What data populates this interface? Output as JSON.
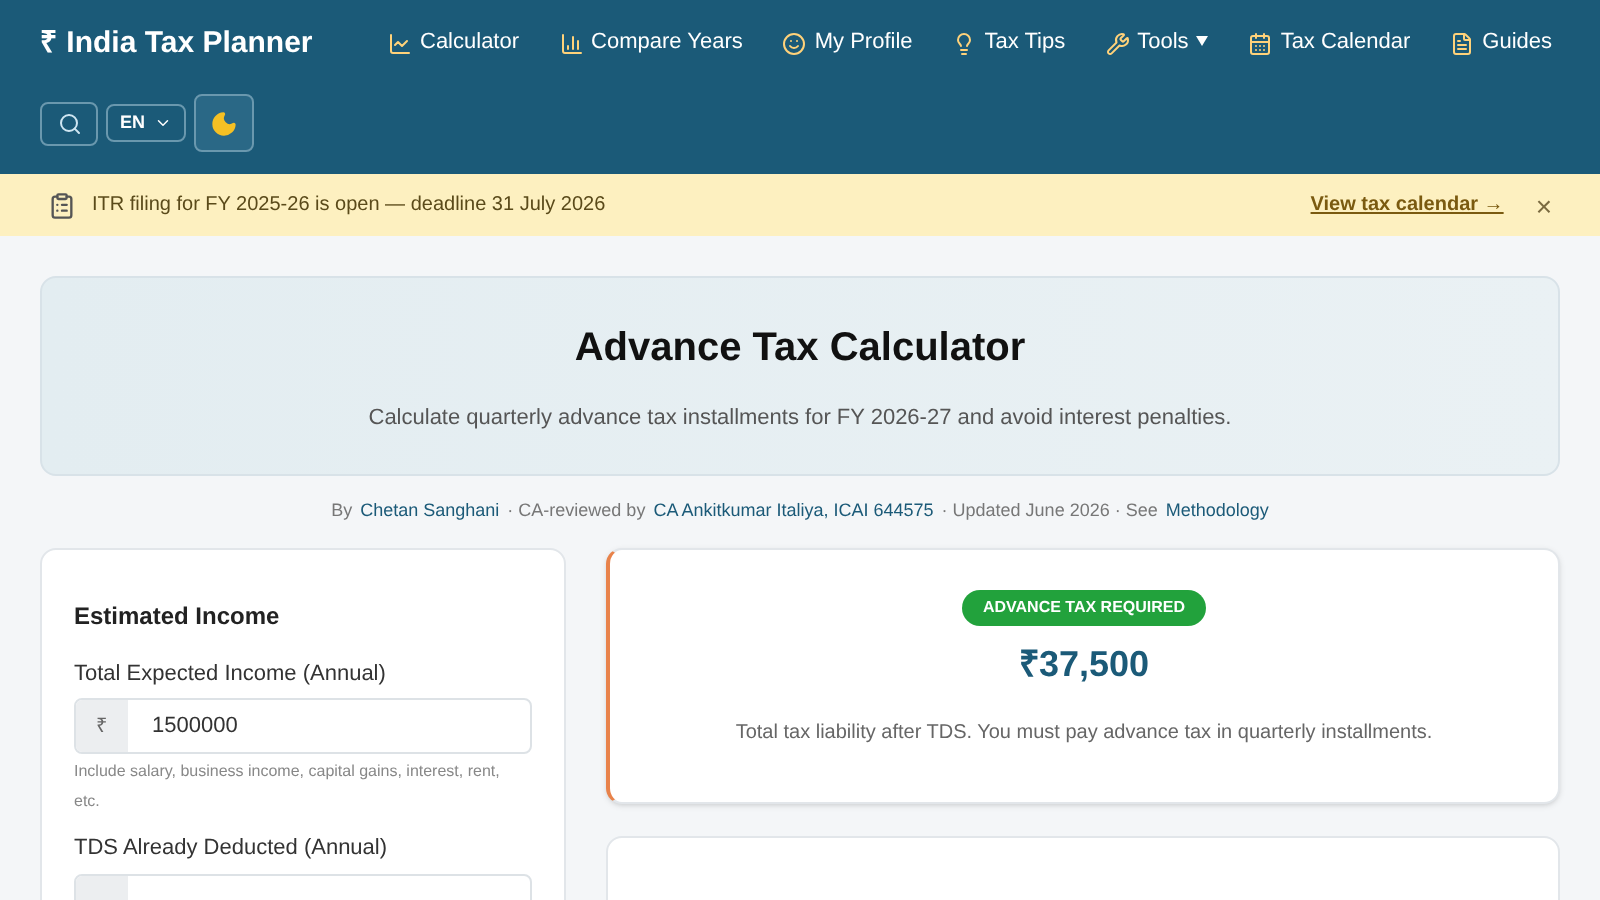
{
  "header": {
    "logo": "₹ India Tax Planner",
    "nav": [
      {
        "label": "Calculator",
        "has_menu": false
      },
      {
        "label": "Compare Years",
        "has_menu": false
      },
      {
        "label": "My Profile",
        "has_menu": false
      },
      {
        "label": "Tax Tips",
        "has_menu": false
      },
      {
        "label": "Tools",
        "has_menu": true
      },
      {
        "label": "Tax Calendar",
        "has_menu": false
      },
      {
        "label": "Guides",
        "has_menu": false
      }
    ],
    "language": "EN"
  },
  "banner": {
    "text": "ITR filing for FY 2025-26 is open — deadline 31 July 2026",
    "link": "View tax calendar →",
    "close": "×"
  },
  "hero": {
    "title": "Advance Tax Calculator",
    "subtitle": "Calculate quarterly advance tax installments for FY 2026-27 and avoid interest penalties."
  },
  "byline": [
    {
      "text": "By",
      "link": false
    },
    {
      "text": "Chetan Sanghani",
      "link": true
    },
    {
      "text": "· CA-reviewed by",
      "link": false
    },
    {
      "text": "CA Ankitkumar Italiya, ICAI 644575",
      "link": true
    },
    {
      "text": "· Updated June 2026 · See",
      "link": false
    },
    {
      "text": "Methodology",
      "link": true
    }
  ],
  "form": {
    "title": "Estimated Income",
    "fields": [
      {
        "label": "Total Expected Income (Annual)",
        "prefix": "₹",
        "value": "1500000",
        "help": "Include salary, business income, capital gains, interest, rent, etc."
      },
      {
        "label": "TDS Already Deducted (Annual)"
      }
    ]
  },
  "result": {
    "badge": "ADVANCE TAX REQUIRED",
    "amount": "₹37,500",
    "note": "Total tax liability after TDS. You must pay advance tax in quarterly installments."
  }
}
